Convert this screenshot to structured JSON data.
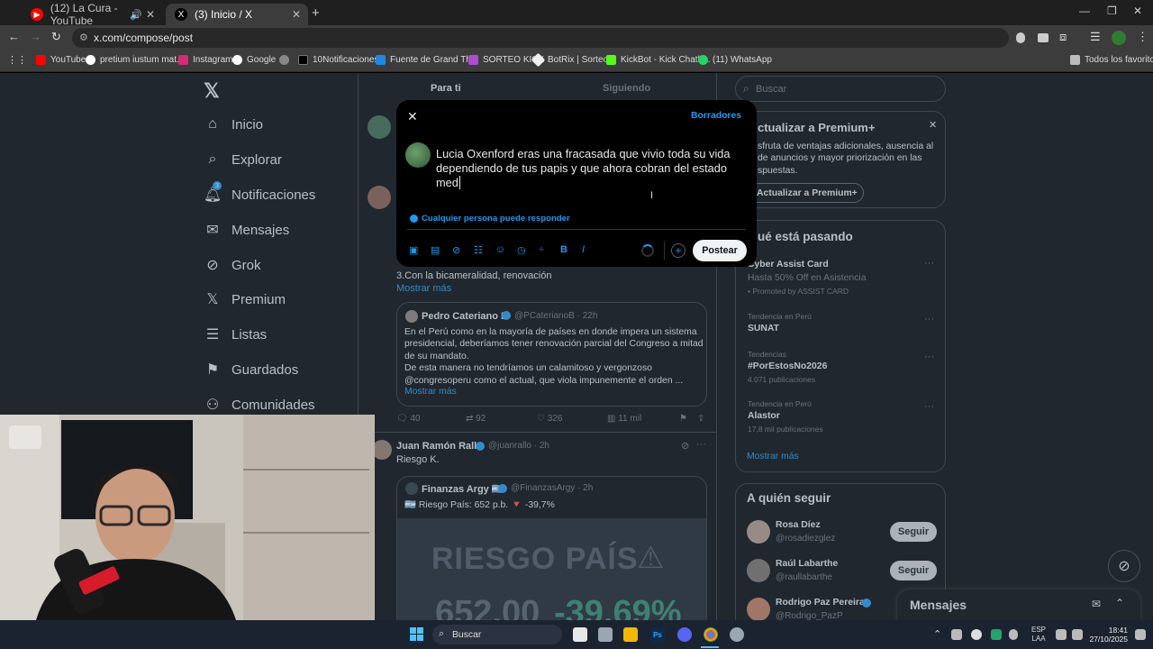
{
  "browser": {
    "tabs": [
      {
        "title": "(12) La Cura - YouTube",
        "favicon": "youtube-icon"
      },
      {
        "title": "(3) Inicio / X",
        "favicon": "x-icon"
      }
    ],
    "url": "x.com/compose/post",
    "bookmarks": [
      "YouTube",
      "pretium iustum mat...",
      "Instagram",
      "Google",
      "10Notificaciones",
      "Fuente de Grand Th...",
      "SORTEO KICK",
      "BotRix | Sorteos",
      "KickBot - Kick Chatb...",
      "(11) WhatsApp"
    ],
    "all_favorites": "Todos los favoritos"
  },
  "nav": {
    "items": [
      "Inicio",
      "Explorar",
      "Notificaciones",
      "Mensajes",
      "Grok",
      "Premium",
      "Listas",
      "Guardados",
      "Comunidades"
    ],
    "notif_badge": "3"
  },
  "feed": {
    "tabs": [
      "Para ti",
      "Siguiendo"
    ],
    "post1_tail": "3.Con la bicameralidad, renovación",
    "show_more": "Mostrar más",
    "quote1": {
      "name": "Pedro Cateriano B",
      "handle": "@PCaterianoB · 22h",
      "text": "En el Perú como en la mayoría de países en donde impera un sistema presidencial, deberíamos tener renovación parcial del Congreso a mitad de su mandato.\nDe esta manera no tendríamos un calamitoso y vergonzoso @congresoperu como el actual, que viola impunemente el orden ...",
      "show_more": "Mostrar más"
    },
    "actions1": {
      "replies": "40",
      "reposts": "92",
      "likes": "326",
      "views": "11 mil"
    },
    "post2": {
      "name": "Juan Ramón Rallo",
      "handle": "@juanrallo · 2h",
      "text": "Riesgo K.",
      "quote_name": "Finanzas Argy 🇦🇷",
      "quote_handle": "@FinanzasArgy · 2h",
      "quote_text": "🇦🇷 Riesgo País: 652 p.b. 🔻 -39,7%",
      "image_title": "RIESGO PAÍS",
      "image_value": "652,00",
      "image_change": "-39,69%"
    }
  },
  "compose": {
    "drafts": "Borradores",
    "text": "Lucia Oxenford eras una fracasada que vivio toda su vida dependiendo de tus papis y que ahora cobran del estado med",
    "reply_setting": "Cualquier persona puede responder",
    "post_button": "Postear"
  },
  "right": {
    "search_placeholder": "Buscar",
    "premium": {
      "title": "ctualizar a Premium+",
      "text": "sfruta de ventajas adicionales, ausencia al de anuncios y mayor priorización en las spuestas.",
      "button": "Actualizar a Premium+"
    },
    "trends": {
      "title": "ué está pasando",
      "items": [
        {
          "context": "",
          "name": "Cyber Assist Card",
          "sub": "Hasta 50% Off en Asistencia",
          "meta": "Promoted by ASSIST CARD"
        },
        {
          "context": "Tendencia en Perú",
          "name": "SUNAT",
          "sub": "",
          "meta": ""
        },
        {
          "context": "Tendencias",
          "name": "#PorEstosNo2026",
          "sub": "",
          "meta": "4.071 publicaciones"
        },
        {
          "context": "Tendencia en Perú",
          "name": "Alastor",
          "sub": "",
          "meta": "17,8 mil publicaciones"
        }
      ],
      "show_more": "Mostrar más"
    },
    "follow": {
      "title": "A quién seguir",
      "items": [
        {
          "name": "Rosa Díez",
          "handle": "@rosadiezglez",
          "button": "Seguir"
        },
        {
          "name": "Raúl Labarthe",
          "handle": "@raullabarthe",
          "button": "Seguir"
        },
        {
          "name": "Rodrigo Paz Pereira",
          "handle": "@Rodrigo_PazP",
          "button": "Seguir"
        }
      ]
    },
    "messages": "Mensajes"
  },
  "taskbar": {
    "search": "Buscar",
    "lang": "ESP",
    "lang2": "LAA",
    "time": "18:41",
    "date": "27/10/2025"
  }
}
